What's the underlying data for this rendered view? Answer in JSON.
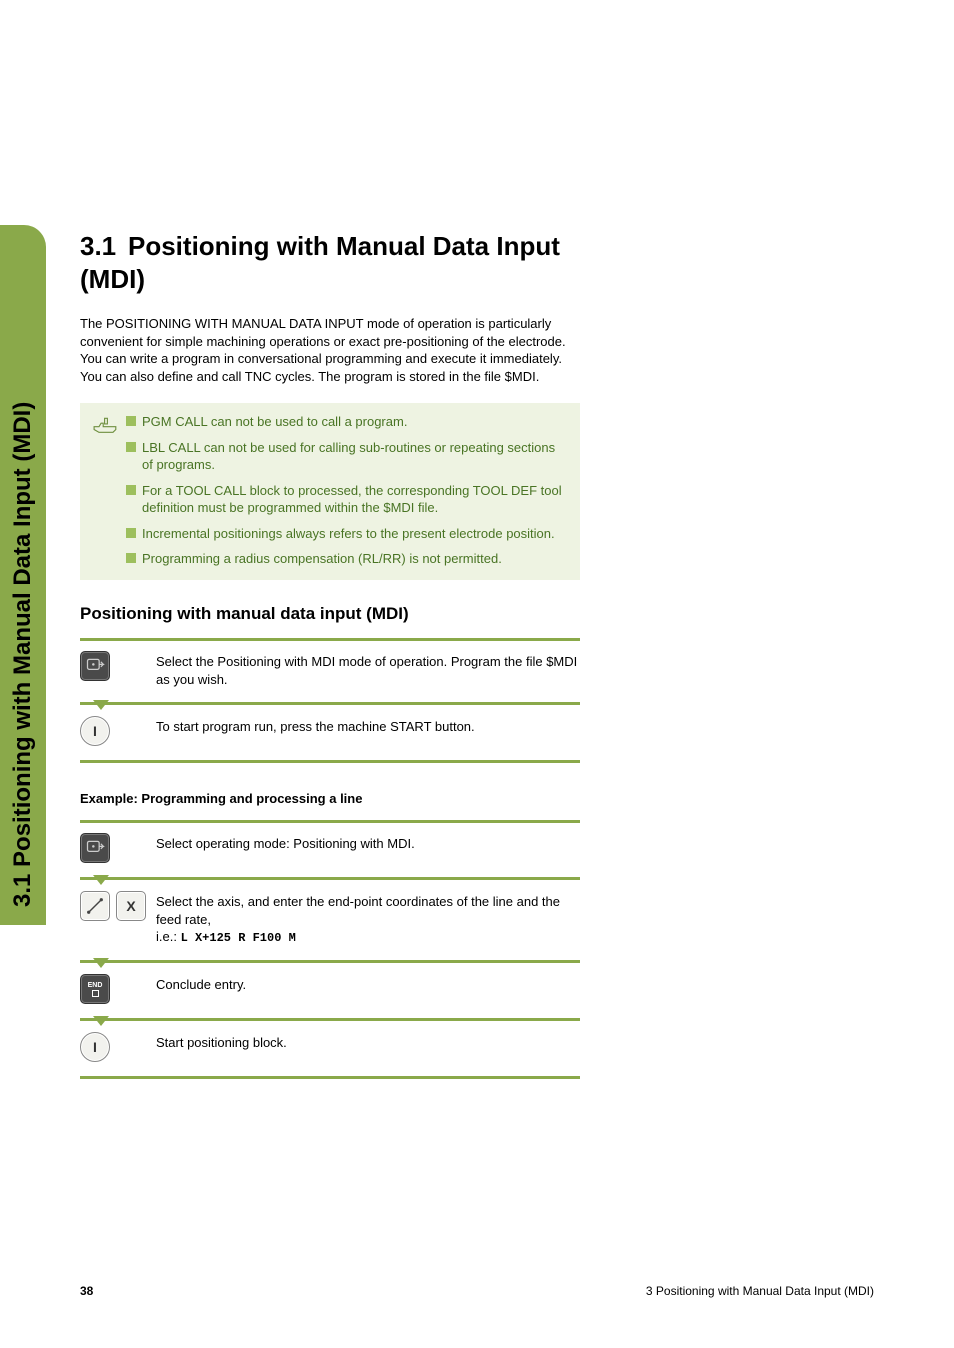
{
  "sideTab": "3.1 Positioning with Manual Data Input (MDI)",
  "heading": {
    "number": "3.1",
    "title": "Positioning with Manual Data Input (MDI)"
  },
  "intro": "The POSITIONING WITH MANUAL DATA INPUT mode of operation is particularly convenient for simple machining operations or exact pre-positioning of the electrode. You can write a program in conversational programming and execute it immediately. You can also define and call TNC cycles. The program is stored in the file $MDI.",
  "infoItems": [
    "PGM CALL can not be used to call a program.",
    "LBL CALL can not be used for calling sub-routines or repeating sections of programs.",
    "For a TOOL CALL block to processed, the corresponding TOOL DEF tool definition must be programmed within the $MDI file.",
    "Incremental positionings always refers to the present electrode position.",
    "Programming a radius compensation (RL/RR) is not permitted."
  ],
  "subheading": "Positioning with manual data input (MDI)",
  "steps1": [
    "Select the Positioning with MDI mode of operation. Program the file $MDI as you wish.",
    "To start program run, press the machine START button."
  ],
  "exampleHeading": "Example: Programming and processing a line",
  "steps2": {
    "s1": "Select operating mode: Positioning with MDI.",
    "s2a": "Select the axis, and enter the end-point coordinates of the line and the feed rate,",
    "s2b": "i.e.: ",
    "s2code": "L X+125 R F100 M",
    "s3": "Conclude entry.",
    "s4": "Start positioning block."
  },
  "keys": {
    "x": "X",
    "i": "I",
    "end": "END"
  },
  "footer": {
    "page": "38",
    "chapter": "3 Positioning with Manual Data Input (MDI)"
  }
}
